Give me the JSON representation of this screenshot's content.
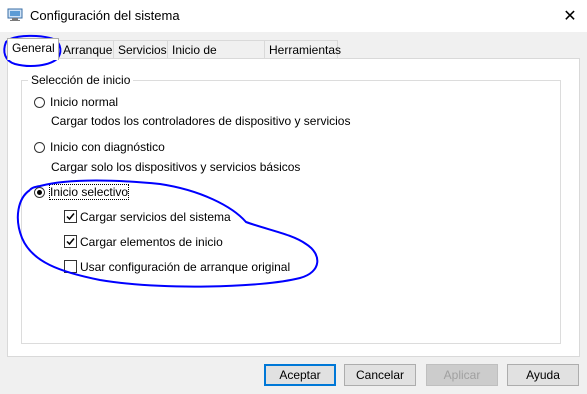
{
  "window": {
    "title": "Configuración del sistema",
    "close_glyph": "✕"
  },
  "tabs": [
    {
      "label": "General"
    },
    {
      "label": "Arranque"
    },
    {
      "label": "Servicios"
    },
    {
      "label": "Inicio de Windows"
    },
    {
      "label": "Herramientas"
    }
  ],
  "startup_selection": {
    "legend": "Selección de inicio",
    "options": [
      {
        "label": "Inicio normal",
        "description": "Cargar todos los controladores de dispositivo y servicios",
        "selected": false
      },
      {
        "label": "Inicio con diagnóstico",
        "description": "Cargar solo los dispositivos y servicios básicos",
        "selected": false
      },
      {
        "label": "Inicio selectivo",
        "selected": true
      }
    ],
    "selective_items": [
      {
        "label": "Cargar servicios del sistema",
        "checked": true
      },
      {
        "label": "Cargar elementos de inicio",
        "checked": true
      },
      {
        "label": "Usar configuración de arranque original",
        "checked": false
      }
    ]
  },
  "buttons": {
    "accept": "Aceptar",
    "cancel": "Cancelar",
    "apply": "Aplicar",
    "help": "Ayuda"
  },
  "annotation_color": "#0000ff"
}
